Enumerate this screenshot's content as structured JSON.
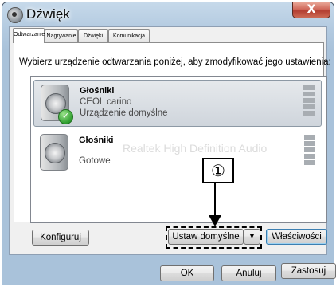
{
  "window": {
    "title": "Dźwięk",
    "close_label": "X"
  },
  "tabs": [
    {
      "label": "Odtwarzanie",
      "active": true
    },
    {
      "label": "Nagrywanie",
      "active": false
    },
    {
      "label": "Dźwięki",
      "active": false
    },
    {
      "label": "Komunikacja",
      "active": false
    }
  ],
  "instruction": "Wybierz urządzenie odtwarzania poniżej, aby zmodyfikować jego ustawienia:",
  "devices": [
    {
      "name": "Głośniki",
      "line1": "CEOL carino",
      "line2": "Urządzenie domyślne",
      "selected": true,
      "default": true,
      "icon": "speaker-icon"
    },
    {
      "name": "Głośniki",
      "line1": "Gotowe",
      "ghost": "Realtek High Definition Audio",
      "selected": false,
      "icon": "speaker-icon"
    }
  ],
  "callout": {
    "number": "①"
  },
  "buttons": {
    "configure": "Konfiguruj",
    "set_default": "Ustaw domyślne",
    "dropdown": "▼",
    "properties": "Właściwości",
    "ok": "OK",
    "cancel": "Anuluj",
    "apply": "Zastosuj"
  },
  "colors": {
    "close_button": "#c4493c",
    "default_check": "#2f9e2f",
    "frame": "#b3cae0"
  }
}
